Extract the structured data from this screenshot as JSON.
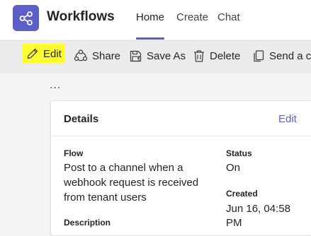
{
  "header": {
    "app_title": "Workflows",
    "app_icon": "workflow-share-icon",
    "tabs": [
      {
        "label": "Home",
        "active": true
      },
      {
        "label": "Create",
        "active": false
      },
      {
        "label": "Chat",
        "active": false
      }
    ],
    "accent_color": "#5b5fc7"
  },
  "toolbar": {
    "edit_label": "Edit",
    "share_label": "Share",
    "save_as_label": "Save As",
    "delete_label": "Delete",
    "send_label": "Send a co",
    "highlight_color": "#ffff2e"
  },
  "more": "...",
  "details": {
    "title": "Details",
    "edit_link": "Edit",
    "flow_label": "Flow",
    "flow_line1": "Post to a channel when a",
    "flow_line2": "webhook request is received",
    "flow_line3": "from tenant users",
    "status_label": "Status",
    "status_value": "On",
    "created_label": "Created",
    "created_line1": "Jun 16, 04:58",
    "created_line2": "PM",
    "description_label": "Description"
  }
}
